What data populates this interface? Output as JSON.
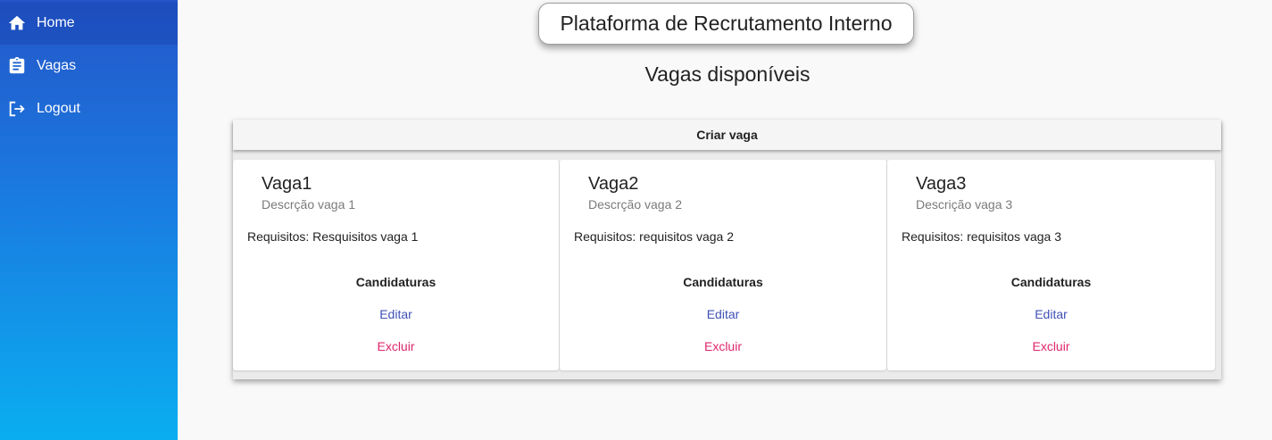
{
  "sidebar": {
    "items": [
      {
        "label": "Home",
        "icon": "home-icon"
      },
      {
        "label": "Vagas",
        "icon": "clipboard-icon"
      },
      {
        "label": "Logout",
        "icon": "logout-icon"
      }
    ],
    "colors": {
      "top": "#2456c9",
      "bottom": "#0aaef0"
    }
  },
  "header": {
    "title": "Plataforma de Recrutamento Interno"
  },
  "main": {
    "heading": "Vagas disponíveis",
    "create_label": "Criar vaga",
    "cards": [
      {
        "title": "Vaga1",
        "description": "Descrção vaga 1",
        "requirements": "Requisitos: Resquisitos vaga 1",
        "applications_label": "Candidaturas",
        "edit_label": "Editar",
        "delete_label": "Excluir"
      },
      {
        "title": "Vaga2",
        "description": "Descrção vaga 2",
        "requirements": "Requisitos: requisitos vaga 2",
        "applications_label": "Candidaturas",
        "edit_label": "Editar",
        "delete_label": "Excluir"
      },
      {
        "title": "Vaga3",
        "description": "Descrição vaga 3",
        "requirements": "Requisitos: requisitos vaga 3",
        "applications_label": "Candidaturas",
        "edit_label": "Editar",
        "delete_label": "Excluir"
      }
    ]
  },
  "colors": {
    "edit": "#3f51b5",
    "delete": "#e0266b"
  }
}
